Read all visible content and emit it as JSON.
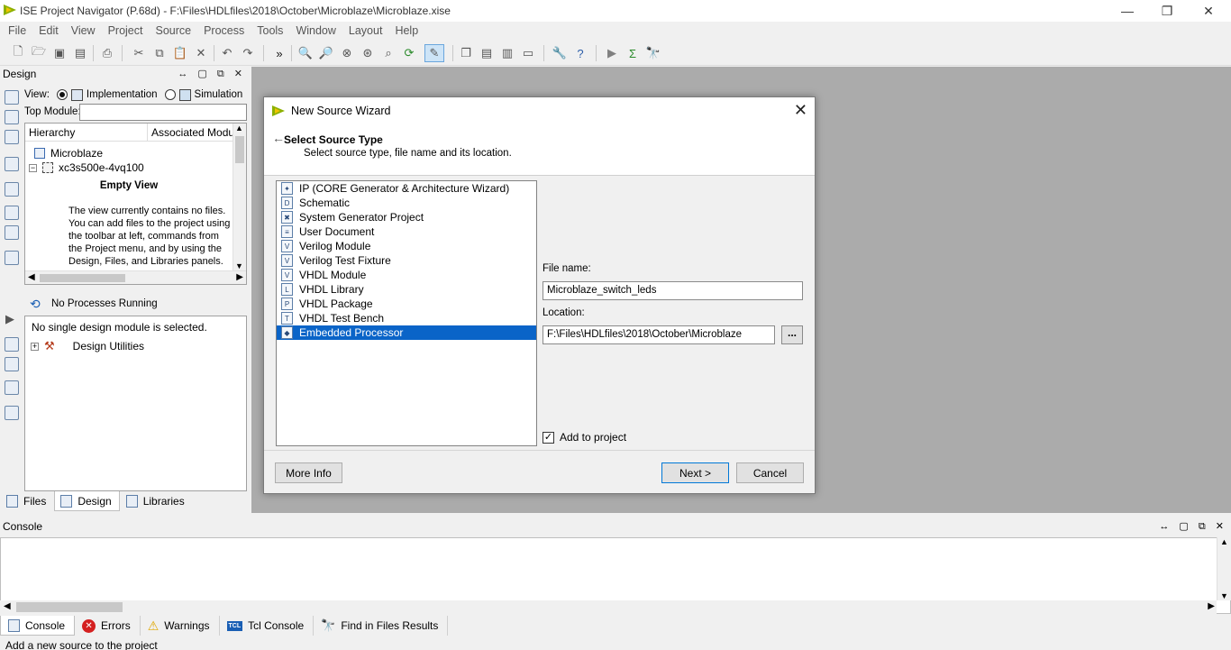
{
  "window": {
    "title": "ISE Project Navigator (P.68d) - F:\\Files\\HDLfiles\\2018\\October\\Microblaze\\Microblaze.xise",
    "minimize": "—",
    "restore": "❐",
    "close": "✕"
  },
  "menu": [
    "File",
    "Edit",
    "View",
    "Project",
    "Source",
    "Process",
    "Tools",
    "Window",
    "Layout",
    "Help"
  ],
  "toolbar": {
    "more": "»"
  },
  "design_panel": {
    "title": "Design",
    "controls": "↔ ▢ ⧉ ✕",
    "view_label": "View:",
    "view_implementation": "Implementation",
    "view_simulation": "Simulation",
    "top_module_label": "Top Module:",
    "top_module_value": "",
    "col_hierarchy": "Hierarchy",
    "col_associated": "Associated Module",
    "tree": [
      {
        "label": "Microblaze",
        "icon": "project-icon"
      },
      {
        "label": "xc3s500e-4vq100",
        "icon": "chip-icon"
      }
    ],
    "empty_title": "Empty View",
    "empty_text": "The view currently contains no files. You can add files to the project using the toolbar at left, commands from the Project menu, and by using the Design, Files, and Libraries panels.",
    "process_status": "No Processes Running",
    "no_module": "No single design module is selected.",
    "design_utilities": "Design Utilities",
    "tabs": [
      "Files",
      "Design",
      "Libraries"
    ]
  },
  "dialog": {
    "title": "New Source Wizard",
    "heading": "Select Source Type",
    "subheading": "Select source type, file name and its location.",
    "source_types": [
      {
        "label": "IP (CORE Generator & Architecture Wizard)",
        "icon": "ip-core-icon",
        "glyph": "✦"
      },
      {
        "label": "Schematic",
        "icon": "schematic-icon",
        "glyph": "D"
      },
      {
        "label": "System Generator Project",
        "icon": "sysgen-icon",
        "glyph": "✖"
      },
      {
        "label": "User Document",
        "icon": "document-icon",
        "glyph": "≡"
      },
      {
        "label": "Verilog Module",
        "icon": "verilog-module-icon",
        "glyph": "V"
      },
      {
        "label": "Verilog Test Fixture",
        "icon": "verilog-test-fixture-icon",
        "glyph": "V"
      },
      {
        "label": "VHDL Module",
        "icon": "vhdl-module-icon",
        "glyph": "V"
      },
      {
        "label": "VHDL Library",
        "icon": "vhdl-library-icon",
        "glyph": "L"
      },
      {
        "label": "VHDL Package",
        "icon": "vhdl-package-icon",
        "glyph": "P"
      },
      {
        "label": "VHDL Test Bench",
        "icon": "vhdl-test-bench-icon",
        "glyph": "T"
      },
      {
        "label": "Embedded Processor",
        "icon": "embedded-processor-icon",
        "glyph": "◆"
      }
    ],
    "selected_index": 10,
    "file_name_label": "File name:",
    "file_name_value": "Microblaze_switch_leds",
    "location_label": "Location:",
    "location_value": "F:\\Files\\HDLfiles\\2018\\October\\Microblaze",
    "browse_label": "...",
    "add_to_project_label": "Add to project",
    "add_to_project_checked": true,
    "more_info": "More Info",
    "next": "Next >",
    "cancel": "Cancel"
  },
  "console": {
    "title": "Console",
    "controls": "↔ ▢ ⧉ ✕",
    "tabs": [
      "Console",
      "Errors",
      "Warnings",
      "Tcl Console",
      "Find in Files Results"
    ]
  },
  "status_bar": "Add a new source to the project",
  "colors": {
    "selection": "#0a64c8",
    "workspace": "#ababab",
    "error_red": "#d42020",
    "warning_yellow": "#f2c200"
  }
}
